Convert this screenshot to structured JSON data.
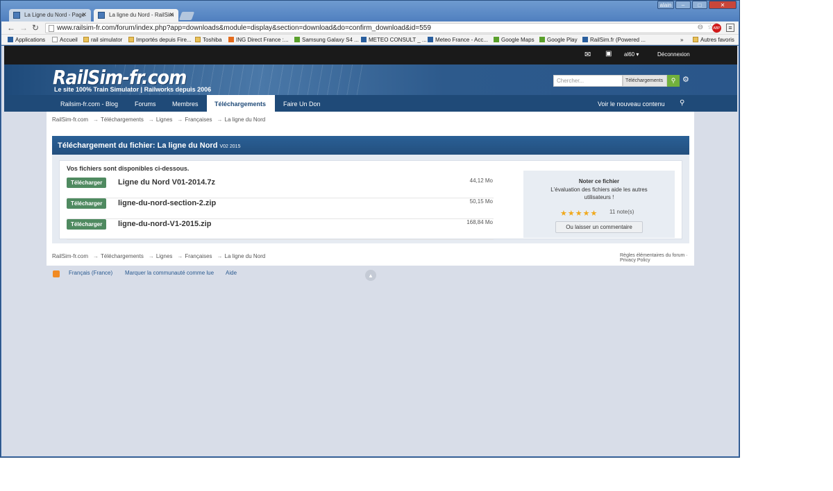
{
  "browser": {
    "tabs": [
      {
        "title": "La Ligne du Nord - Page"
      },
      {
        "title": "La ligne du Nord - RailSim"
      }
    ],
    "user_badge": "alain",
    "url": "www.railsim-fr.com/forum/index.php?app=downloads&module=display&section=download&do=confirm_download&id=559",
    "adblock": "ABP",
    "bookmarks": [
      {
        "label": "Applications",
        "icon": "apps-grid-icon"
      },
      {
        "label": "Accueil",
        "icon": "page-icon"
      },
      {
        "label": "rail simulator",
        "icon": "folder-icon"
      },
      {
        "label": "Importés depuis Fire...",
        "icon": "folder-icon"
      },
      {
        "label": "Toshiba",
        "icon": "folder-icon"
      },
      {
        "label": "ING Direct France :...",
        "icon": "ing-icon"
      },
      {
        "label": "Samsung Galaxy S4 ...",
        "icon": "android-icon"
      },
      {
        "label": "METEO CONSULT _ ...",
        "icon": "meteo-consult-icon"
      },
      {
        "label": "Meteo France - Acc...",
        "icon": "meteo-france-icon"
      },
      {
        "label": "Google Maps",
        "icon": "maps-icon"
      },
      {
        "label": "Google Play",
        "icon": "play-icon"
      },
      {
        "label": "RailSim.fr (Powered ...",
        "icon": "railsim-icon"
      }
    ],
    "more": "»",
    "other_bookmarks": "Autres favoris"
  },
  "userbar": {
    "username": "al60",
    "logout": "Déconnexion"
  },
  "header": {
    "logo": "RailSim-fr.com",
    "tagline": "Le site 100% Train Simulator | Railworks depuis 2006",
    "search_placeholder": "Chercher...",
    "search_scope": "Téléchargements"
  },
  "nav": {
    "items": [
      "Railsim-fr.com - Blog",
      "Forums",
      "Membres",
      "Téléchargements",
      "Faire Un Don"
    ],
    "new_content": "Voir le nouveau contenu"
  },
  "breadcrumb": [
    "RailSim-fr.com",
    "Téléchargements",
    "Lignes",
    "Françaises",
    "La ligne du Nord"
  ],
  "box": {
    "title": "Téléchargement du fichier: La ligne du Nord",
    "version": "V02 2015",
    "files_heading": "Vos fichiers sont disponibles ci-dessous.",
    "download_label": "Télécharger",
    "files": [
      {
        "name": "Ligne du Nord V01-2014.7z",
        "size": "44,12 Mo"
      },
      {
        "name": "ligne-du-nord-section-2.zip",
        "size": "50,15 Mo"
      },
      {
        "name": "ligne-du-nord-V1-2015.zip",
        "size": "168,84 Mo"
      }
    ]
  },
  "rating": {
    "title": "Noter ce fichier",
    "description": "L'évaluation des fichiers aide les autres utilisateurs !",
    "stars": 5,
    "notes": "11 note(s)",
    "comment_button": "Ou laisser un commentaire"
  },
  "footer": {
    "rules": "Règles élémentaires du forum",
    "separator": "·",
    "privacy": "Privacy Policy",
    "language": "Français (France)",
    "mark_read": "Marquer la communauté comme lue",
    "help": "Aide"
  }
}
